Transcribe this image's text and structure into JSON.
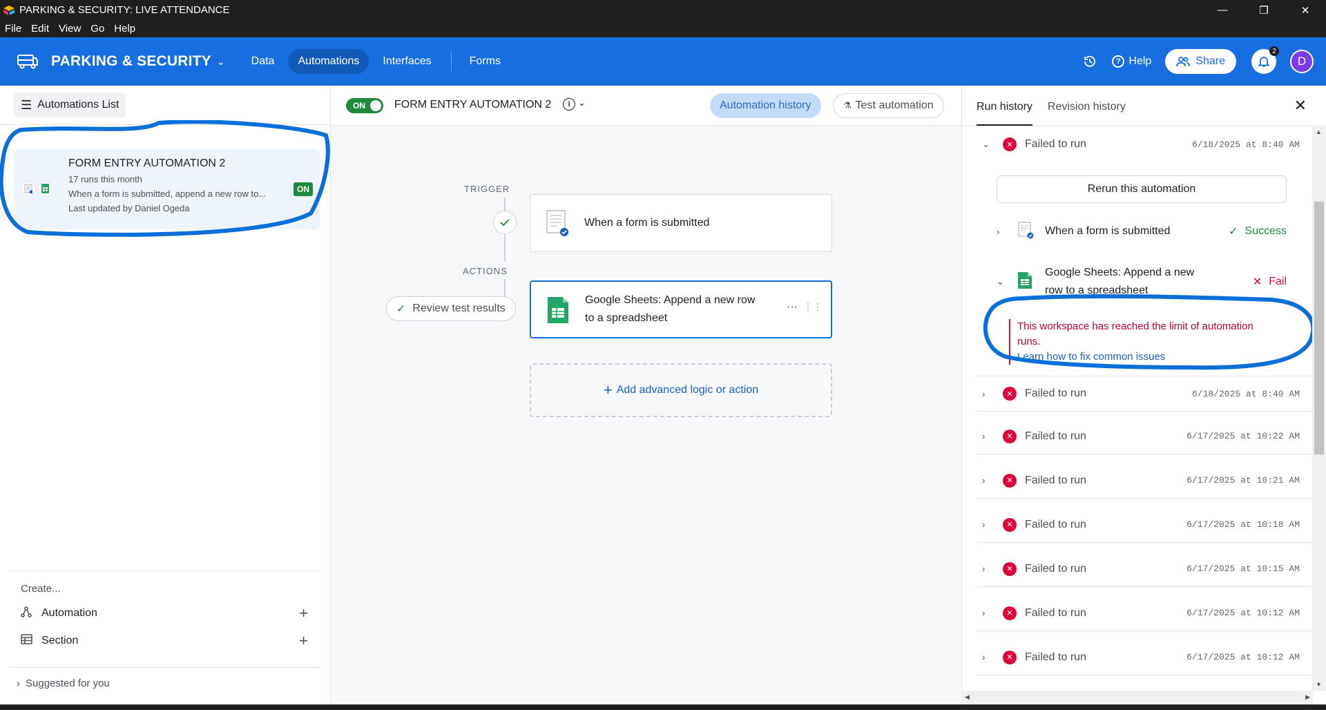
{
  "window": {
    "title": "PARKING & SECURITY: LIVE ATTENDANCE",
    "controls": [
      "minimize-icon",
      "restore-icon",
      "close-icon"
    ]
  },
  "menu": [
    "File",
    "Edit",
    "View",
    "Go",
    "Help"
  ],
  "header": {
    "base_name": "PARKING & SECURITY",
    "nav": [
      "Data",
      "Automations",
      "Interfaces",
      "Forms"
    ],
    "help": "Help",
    "share": "Share",
    "notifications": "2",
    "avatar": "D",
    "brand_color": "#166ee1"
  },
  "sidebar": {
    "list_button": "Automations List",
    "automation": {
      "name": "FORM ENTRY AUTOMATION 2",
      "runs": "17 runs this month",
      "description": "When a form is submitted, append a new row to...",
      "updated": "Last updated by Daniel Ogeda",
      "status": "ON"
    },
    "create_label": "Create...",
    "create_items": [
      "Automation",
      "Section"
    ],
    "suggested": "Suggested for you"
  },
  "canvas": {
    "toggle": "ON",
    "title": "FORM ENTRY AUTOMATION 2",
    "history_button": "Automation history",
    "test_button": "Test automation",
    "trigger_label": "TRIGGER",
    "actions_label": "ACTIONS",
    "trigger_step": "When a form is submitted",
    "action_step_line1": "Google Sheets: Append a new row",
    "action_step_line2": "to a spreadsheet",
    "review_button": "Review test results",
    "add_logic": "Add advanced logic or action"
  },
  "run_panel": {
    "tabs": [
      "Run history",
      "Revision history"
    ],
    "expanded_run": {
      "status": "Failed to run",
      "when": "6/18/2025 at 8:40 AM",
      "rerun": "Rerun this automation",
      "step1": "When a form is submitted",
      "step1_result": "Success",
      "step2_line1": "Google Sheets: Append a new",
      "step2_line2": "row to a spreadsheet",
      "step2_result": "Fail",
      "error_line1": "This workspace has reached the limit of automation",
      "error_line2": "runs.",
      "error_link": "Learn how to fix common issues"
    },
    "runs": [
      {
        "status": "Failed to run",
        "when": "6/18/2025 at 8:40 AM"
      },
      {
        "status": "Failed to run",
        "when": "6/17/2025 at 10:22 AM"
      },
      {
        "status": "Failed to run",
        "when": "6/17/2025 at 10:21 AM"
      },
      {
        "status": "Failed to run",
        "when": "6/17/2025 at 10:18 AM"
      },
      {
        "status": "Failed to run",
        "when": "6/17/2025 at 10:15 AM"
      },
      {
        "status": "Failed to run",
        "when": "6/17/2025 at 10:12 AM"
      },
      {
        "status": "Failed to run",
        "when": "6/17/2025 at 10:12 AM"
      }
    ],
    "error_color": "#dc043b",
    "success_color": "#1f8a3b"
  }
}
